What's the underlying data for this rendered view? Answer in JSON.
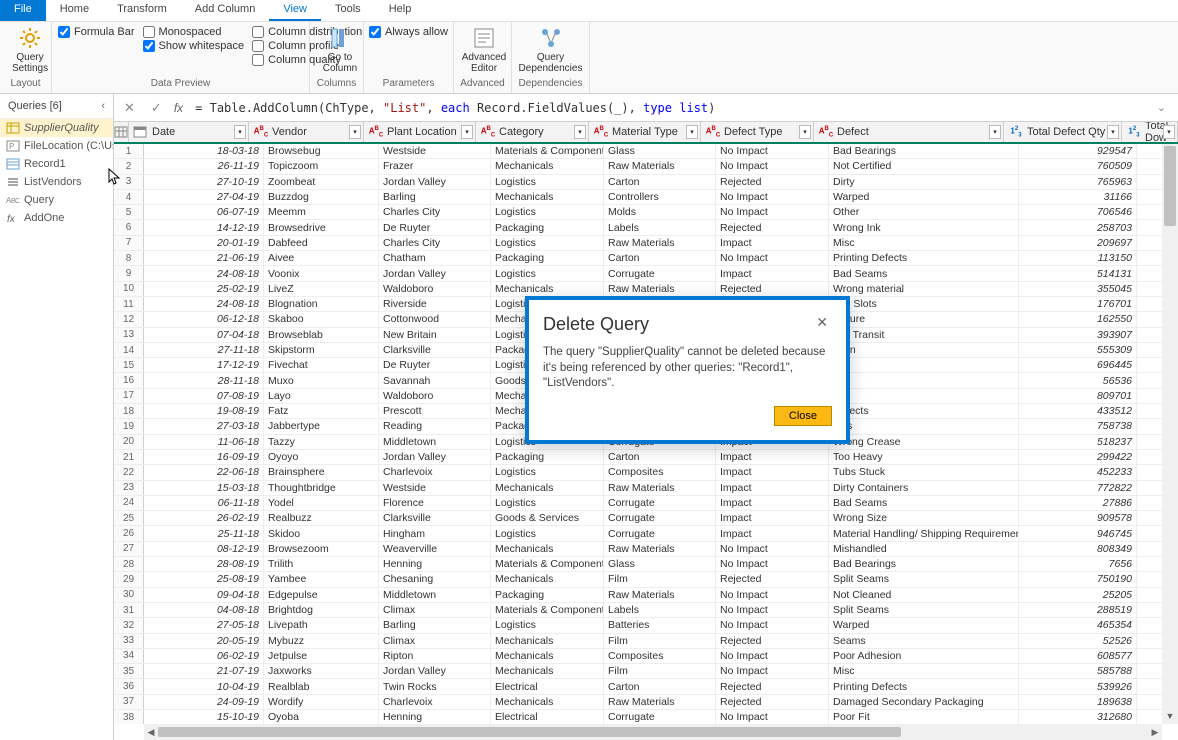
{
  "menu": {
    "file": "File",
    "home": "Home",
    "transform": "Transform",
    "addcol": "Add Column",
    "view": "View",
    "tools": "Tools",
    "help": "Help"
  },
  "ribbon": {
    "qs": "Query\nSettings",
    "layout": "Layout",
    "chk_formula": "Formula Bar",
    "chk_mono": "Monospaced",
    "chk_ws": "Show whitespace",
    "chk_coldist": "Column distribution",
    "chk_colprof": "Column profile",
    "chk_colqual": "Column quality",
    "chk_allow": "Always allow",
    "datapreview": "Data Preview",
    "goto": "Go to\nColumn",
    "columns": "Columns",
    "adv": "Advanced\nEditor",
    "params": "Parameters",
    "advanced": "Advanced",
    "qdep": "Query\nDependencies",
    "deps": "Dependencies"
  },
  "sidebar": {
    "title": "Queries [6]",
    "items": [
      {
        "name": "SupplierQuality",
        "icon": "table",
        "sel": true
      },
      {
        "name": "FileLocation (C:\\Users...",
        "icon": "param",
        "sel": false
      },
      {
        "name": "Record1",
        "icon": "record",
        "sel": false
      },
      {
        "name": "ListVendors",
        "icon": "list",
        "sel": false
      },
      {
        "name": "Query",
        "icon": "abc",
        "sel": false
      },
      {
        "name": "AddOne",
        "icon": "fx",
        "sel": false
      }
    ]
  },
  "formula": {
    "prefix": "= Table.AddColumn(ChType, ",
    "str1": "\"List\"",
    "mid": ", ",
    "kw_each": "each",
    "mid2": " Record.FieldValues(_), ",
    "kw_type": "type",
    "mid3": " ",
    "kw_list": "list",
    "suffix": ")"
  },
  "columns": [
    {
      "label": "Date",
      "type": "date"
    },
    {
      "label": "Vendor",
      "type": "abc"
    },
    {
      "label": "Plant Location",
      "type": "abc"
    },
    {
      "label": "Category",
      "type": "abc"
    },
    {
      "label": "Material Type",
      "type": "abc"
    },
    {
      "label": "Defect Type",
      "type": "abc"
    },
    {
      "label": "Defect",
      "type": "abc"
    },
    {
      "label": "Total Defect Qty",
      "type": "num"
    },
    {
      "label": "Total Dow",
      "type": "num"
    }
  ],
  "rows": [
    [
      "18-03-18",
      "Browsebug",
      "Westside",
      "Materials & Components",
      "Glass",
      "No Impact",
      "Bad Bearings",
      "929547"
    ],
    [
      "26-11-19",
      "Topiczoom",
      "Frazer",
      "Mechanicals",
      "Raw Materials",
      "No Impact",
      "Not Certified",
      "760509"
    ],
    [
      "27-10-19",
      "Zoombeat",
      "Jordan Valley",
      "Logistics",
      "Carton",
      "Rejected",
      "Dirty",
      "765963"
    ],
    [
      "27-04-19",
      "Buzzdog",
      "Barling",
      "Mechanicals",
      "Controllers",
      "No Impact",
      "Warped",
      "31166"
    ],
    [
      "06-07-19",
      "Meemm",
      "Charles City",
      "Logistics",
      "Molds",
      "No Impact",
      "Other",
      "706546"
    ],
    [
      "14-12-19",
      "Browsedrive",
      "De Ruyter",
      "Packaging",
      "Labels",
      "Rejected",
      "Wrong Ink",
      "258703"
    ],
    [
      "20-01-19",
      "Dabfeed",
      "Charles City",
      "Logistics",
      "Raw Materials",
      "Impact",
      "Misc",
      "209697"
    ],
    [
      "21-06-19",
      "Aivee",
      "Chatham",
      "Packaging",
      "Carton",
      "No Impact",
      "Printing Defects",
      "113150"
    ],
    [
      "24-08-18",
      "Voonix",
      "Jordan Valley",
      "Logistics",
      "Corrugate",
      "Impact",
      "Bad Seams",
      "514131"
    ],
    [
      "25-02-19",
      "LiveZ",
      "Waldoboro",
      "Mechanicals",
      "Raw Materials",
      "Rejected",
      "Wrong material",
      "355045"
    ],
    [
      "24-08-18",
      "Blognation",
      "Riverside",
      "Logistics",
      "",
      "",
      "ned Slots",
      "176701"
    ],
    [
      "06-12-18",
      "Skaboo",
      "Cottonwood",
      "Mechanic",
      "",
      "",
      "Failure",
      "162550"
    ],
    [
      "07-04-18",
      "Browseblab",
      "New Britain",
      "Logistics",
      "",
      "",
      "d in Transit",
      "393907"
    ],
    [
      "27-11-18",
      "Skipstorm",
      "Clarksville",
      "Packaging",
      "",
      "",
      "ation",
      "555309"
    ],
    [
      "17-12-19",
      "Fivechat",
      "De Ruyter",
      "Logistics",
      "",
      "",
      "ck",
      "696445"
    ],
    [
      "28-11-18",
      "Muxo",
      "Savannah",
      "Goods & S",
      "",
      "",
      "ms",
      "56536"
    ],
    [
      "07-08-19",
      "Layo",
      "Waldoboro",
      "Mechanic",
      "",
      "",
      "",
      "809701"
    ],
    [
      "19-08-19",
      "Fatz",
      "Prescott",
      "Mechanic",
      "",
      "",
      "Defects",
      "433512"
    ],
    [
      "27-03-18",
      "Jabbertype",
      "Reading",
      "Packaging",
      "",
      "",
      "ects",
      "758738"
    ],
    [
      "11-06-18",
      "Tazzy",
      "Middletown",
      "Logistics",
      "Corrugate",
      "Impact",
      "Wrong Crease",
      "518237"
    ],
    [
      "16-09-19",
      "Oyoyo",
      "Jordan Valley",
      "Packaging",
      "Carton",
      "Impact",
      "Too Heavy",
      "299422"
    ],
    [
      "22-06-18",
      "Brainsphere",
      "Charlevoix",
      "Logistics",
      "Composites",
      "Impact",
      "Tubs Stuck",
      "452233"
    ],
    [
      "15-03-18",
      "Thoughtbridge",
      "Westside",
      "Mechanicals",
      "Raw Materials",
      "Impact",
      "Dirty Containers",
      "772822"
    ],
    [
      "06-11-18",
      "Yodel",
      "Florence",
      "Logistics",
      "Corrugate",
      "Impact",
      "Bad Seams",
      "27886"
    ],
    [
      "26-02-19",
      "Realbuzz",
      "Clarksville",
      "Goods & Services",
      "Corrugate",
      "Impact",
      "Wrong  Size",
      "909578"
    ],
    [
      "25-11-18",
      "Skidoo",
      "Hingham",
      "Logistics",
      "Corrugate",
      "Impact",
      "Material Handling/ Shipping Requirements Error",
      "946745"
    ],
    [
      "08-12-19",
      "Browsezoom",
      "Weaverville",
      "Mechanicals",
      "Raw Materials",
      "No Impact",
      "Mishandled",
      "808349"
    ],
    [
      "28-08-19",
      "Trilith",
      "Henning",
      "Materials & Components",
      "Glass",
      "No Impact",
      "Bad Bearings",
      "7656"
    ],
    [
      "25-08-19",
      "Yambee",
      "Chesaning",
      "Mechanicals",
      "Film",
      "Rejected",
      "Split Seams",
      "750190"
    ],
    [
      "09-04-18",
      "Edgepulse",
      "Middletown",
      "Packaging",
      "Raw Materials",
      "No Impact",
      "Not Cleaned",
      "25205"
    ],
    [
      "04-08-18",
      "Brightdog",
      "Climax",
      "Materials & Components",
      "Labels",
      "No Impact",
      "Split Seams",
      "288519"
    ],
    [
      "27-05-18",
      "Livepath",
      "Barling",
      "Logistics",
      "Batteries",
      "No Impact",
      "Warped",
      "465354"
    ],
    [
      "20-05-19",
      "Mybuzz",
      "Climax",
      "Mechanicals",
      "Film",
      "Rejected",
      "Seams",
      "52526"
    ],
    [
      "06-02-19",
      "Jetpulse",
      "Ripton",
      "Mechanicals",
      "Composites",
      "No Impact",
      "Poor  Adhesion",
      "608577"
    ],
    [
      "21-07-19",
      "Jaxworks",
      "Jordan Valley",
      "Mechanicals",
      "Film",
      "No Impact",
      "Misc",
      "585788"
    ],
    [
      "10-04-19",
      "Realblab",
      "Twin Rocks",
      "Electrical",
      "Carton",
      "Rejected",
      "Printing Defects",
      "539926"
    ],
    [
      "24-09-19",
      "Wordify",
      "Charlevoix",
      "Mechanicals",
      "Raw Materials",
      "Rejected",
      "Damaged Secondary Packaging",
      "189638"
    ],
    [
      "15-10-19",
      "Oyoba",
      "Henning",
      "Electrical",
      "Corrugate",
      "No Impact",
      "Poor Fit",
      "312680"
    ],
    [
      "",
      "",
      "",
      "",
      "",
      "",
      "",
      ""
    ]
  ],
  "dialog": {
    "title": "Delete Query",
    "body": "The query \"SupplierQuality\" cannot be deleted because it's being referenced by other queries: \"Record1\", \"ListVendors\".",
    "close": "Close"
  }
}
